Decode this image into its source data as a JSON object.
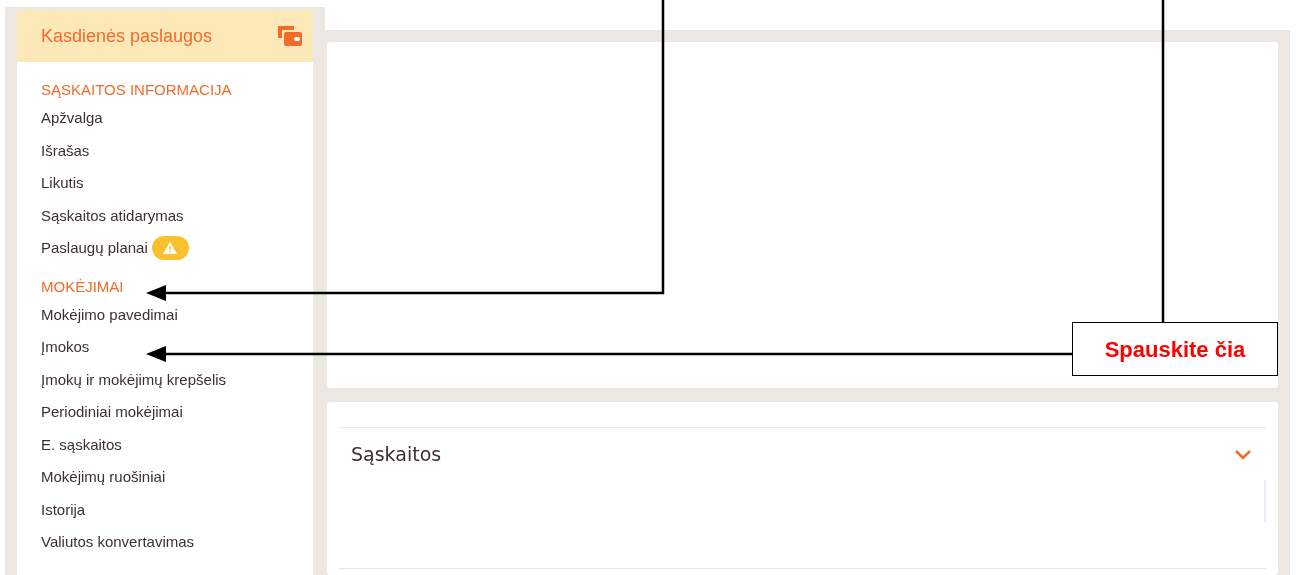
{
  "sidebar": {
    "header": {
      "title": "Kasdienės paslaugos"
    },
    "sections": [
      {
        "title": "SĄSKAITOS INFORMACIJA",
        "items": [
          {
            "label": "Apžvalga",
            "warning": false
          },
          {
            "label": "Išrašas",
            "warning": false
          },
          {
            "label": "Likutis",
            "warning": false
          },
          {
            "label": "Sąskaitos atidarymas",
            "warning": false
          },
          {
            "label": "Paslaugų planai",
            "warning": true
          }
        ]
      },
      {
        "title": "MOKĖJIMAI",
        "items": [
          {
            "label": "Mokėjimo pavedimai",
            "warning": false
          },
          {
            "label": "Įmokos",
            "warning": false
          },
          {
            "label": "Įmokų ir mokėjimų krepšelis",
            "warning": false
          },
          {
            "label": "Periodiniai mokėjimai",
            "warning": false
          },
          {
            "label": "E. sąskaitos",
            "warning": false
          },
          {
            "label": "Mokėjimų ruošiniai",
            "warning": false
          },
          {
            "label": "Istorija",
            "warning": false
          },
          {
            "label": "Valiutos konvertavimas",
            "warning": false
          }
        ]
      }
    ]
  },
  "main": {
    "accordion": {
      "title": "Sąskaitos",
      "expanded": false
    }
  },
  "callout": {
    "text": "Spauskite čia"
  }
}
